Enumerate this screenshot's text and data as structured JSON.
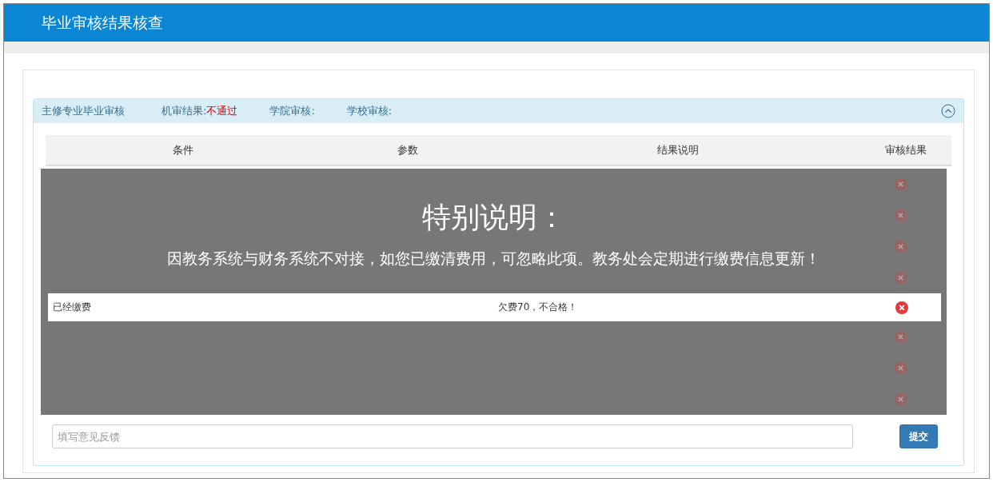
{
  "header": {
    "title": "毕业审核结果核查"
  },
  "panel": {
    "title": "主修专业毕业审核",
    "machine_review_label": "机审结果:",
    "machine_review_value": "不通过",
    "college_review_label": "学院审核:",
    "school_review_label": "学校审核:",
    "expanded": true
  },
  "table": {
    "columns": [
      "条件",
      "参数",
      "结果说明",
      "审核结果"
    ],
    "visible_row": {
      "condition": "已经缴费",
      "result": "欠费70，不合格！",
      "passed": false
    }
  },
  "notice": {
    "title": "特别说明：",
    "message": "因教务系统与财务系统不对接，如您已缴清费用，可忽略此项。教务处会定期进行缴费信息更新！"
  },
  "feedback": {
    "placeholder": "填写意见反馈",
    "submit": "提交"
  }
}
